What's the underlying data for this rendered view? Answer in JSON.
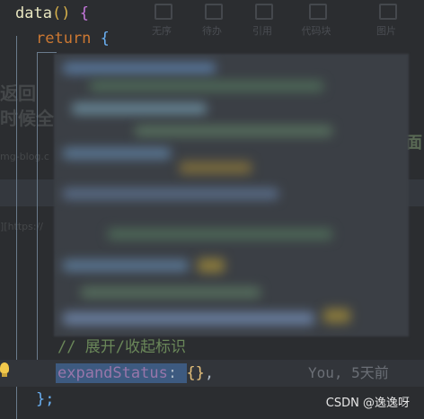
{
  "code": {
    "line1": {
      "fn": "data",
      "paren": "()",
      "brace": "{"
    },
    "line2": {
      "keyword": "return",
      "brace": "{"
    },
    "comment": "// 展开/收起标识",
    "line4": {
      "prop": "expandStatus",
      "colon": ":",
      "value": "{}",
      "comma": ","
    },
    "blame": "You, 5天前",
    "closing": "};"
  },
  "ghost": {
    "toolbar": [
      "无序",
      "待办",
      "引用",
      "代码块",
      "图片"
    ],
    "side_text": "返回",
    "side_text2": "时候全",
    "right_text": "面",
    "link1": "mg-blog.c",
    "link2": "][https://"
  },
  "watermark": "CSDN @逸逸呀",
  "colors": {
    "background": "#2b2d30",
    "keyword": "#cc7832",
    "comment": "#6a8759",
    "property": "#9876aa",
    "selection": "#3d5a80"
  }
}
